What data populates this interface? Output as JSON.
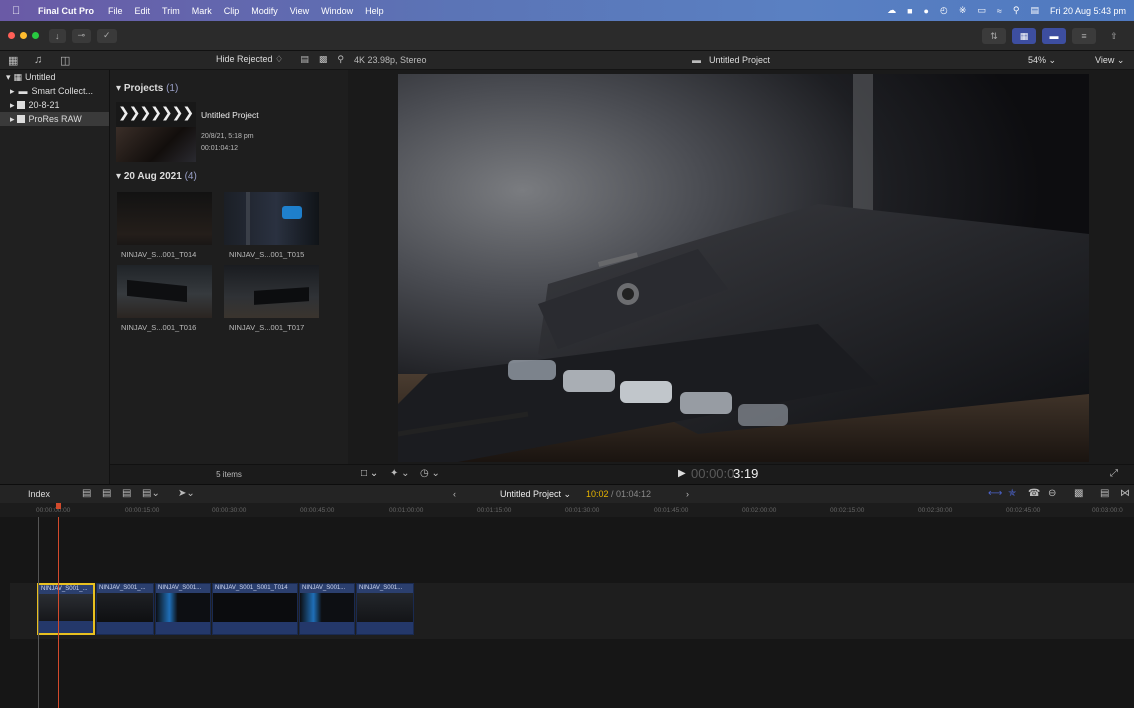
{
  "menubar": {
    "app": "Final Cut Pro",
    "items": [
      "File",
      "Edit",
      "Trim",
      "Mark",
      "Clip",
      "Modify",
      "View",
      "Window",
      "Help"
    ],
    "datetime": "Fri 20 Aug 5:43 pm"
  },
  "library": {
    "hide_rejected": "Hide Rejected ♢",
    "items": [
      {
        "label": "Untitled"
      },
      {
        "label": "Smart Collect..."
      },
      {
        "label": "20-8-21"
      },
      {
        "label": "ProRes RAW"
      }
    ]
  },
  "browser": {
    "projects_header": "Projects",
    "projects_count": "(1)",
    "project": {
      "name": "Untitled Project",
      "date": "20/8/21, 5:18 pm",
      "duration": "00:01:04:12"
    },
    "event_header": "20 Aug 2021",
    "event_count": "(4)",
    "clips": [
      "NINJAV_S...001_T014",
      "NINJAV_S...001_T015",
      "NINJAV_S...001_T016",
      "NINJAV_S...001_T017"
    ],
    "footer": "5 items"
  },
  "viewer": {
    "format": "4K 23.98p, Stereo",
    "title": "Untitled Project",
    "zoom": "54% ⌄",
    "view": "View ⌄",
    "timecode_dim": "00:00:0",
    "timecode": "3:19"
  },
  "timeline": {
    "index": "Index",
    "project": "Untitled Project ⌄",
    "pos": "10:02",
    "total": "/ 01:04:12",
    "ruler": [
      "00:00:00:00",
      "00:00:15:00",
      "00:00:30:00",
      "00:00:45:00",
      "00:01:00:00",
      "00:01:15:00",
      "00:01:30:00",
      "00:01:45:00",
      "00:02:00:00",
      "00:02:15:00",
      "00:02:30:00",
      "00:02:45:00",
      "00:03:00:0"
    ],
    "clips": [
      "NINJAV_S001_...",
      "NINJAV_S001_...",
      "NINJAV_S001...",
      "NINJAV_S001_S001_T014",
      "NINJAV_S001...",
      "NINJAV_S001..."
    ]
  }
}
